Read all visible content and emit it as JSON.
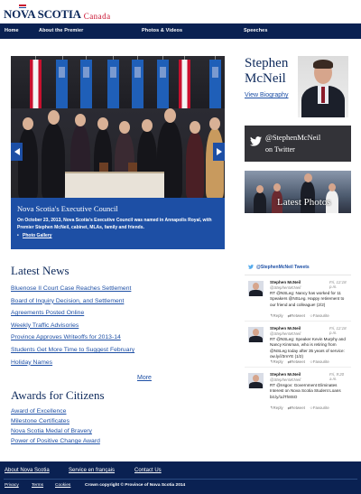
{
  "header": {
    "logo_main": "NOVA SCOTIA",
    "logo_sub": "Canada"
  },
  "nav": {
    "items": [
      "Home",
      "About the Premier",
      "Photos & Videos",
      "Speeches"
    ]
  },
  "hero": {
    "title": "Nova Scotia's Executive Council",
    "text": "On October 23, 2013, Nova Scotia's Executive Council was named in Annapolis Royal, with Premier Stephen McNeil, cabinet, MLAs, family and friends.",
    "link": "Photo Gallery",
    "prev_icon": "triangle-left",
    "next_icon": "triangle-right"
  },
  "premier": {
    "name_line1": "Stephen",
    "name_line2": "McNeil",
    "bio_link": "View Biography"
  },
  "twitter_box": {
    "handle": "@StephenMcNeil",
    "sub": "on Twitter"
  },
  "latest_photos": {
    "label": "Latest Photos"
  },
  "news": {
    "title": "Latest News",
    "items": [
      "Bluenose II Court Case Reaches Settlement",
      "Board of Inquiry Decision, and Settlement",
      "Agreements Posted Online",
      "Weekly Traffic Advisories",
      "Province Approves Writeoffs for 2013-14",
      "Students Get More Time to Suggest February",
      "Holiday Names"
    ],
    "more": "More"
  },
  "awards": {
    "title": "Awards for Citizens",
    "items": [
      "Award of Excellence",
      "Milestone Certificates",
      "Nova Scotia Medal of Bravery",
      "Power of Positive Change Award"
    ]
  },
  "tweets": {
    "header": "@StephenMcNeil Tweets",
    "list": [
      {
        "name": "Stephen McNeil",
        "handle": "@StephenMcNeil",
        "time": "Fri, 12:18 p.m.",
        "body": "RT @NSLeg: Nancy has worked for 11 Speakers @NSLeg. Happy retirement to our friend and colleague! (2/2)"
      },
      {
        "name": "Stephen McNeil",
        "handle": "@StephenMcNeil",
        "time": "Fri, 12:18 p.m.",
        "body": "RT @NSLeg: Speaker Kevin Murphy and Nancy Kinsman, who is retiring from @NSLeg today after 35 years of service: ow.ly/i/3mYE (1/2)"
      },
      {
        "name": "Stephen McNeil",
        "handle": "@StephenMcNeil",
        "time": "Fri, 9:20 a.m.",
        "body": "RT @nsgov: Government Eliminates Interest on Nova Scotia Student Loans bit.ly/1dTh8SO"
      }
    ],
    "actions": [
      "Reply",
      "Retweet",
      "Favourite"
    ]
  },
  "footer": {
    "links": [
      "About Nova Scotia",
      "Service en français",
      "Contact Us"
    ],
    "small_links": [
      "Privacy",
      "Terms",
      "Cookies"
    ],
    "copyright": "Crown copyright © Province of Nova Scotia 2014"
  },
  "colors": {
    "navy": "#0a2152",
    "accent_blue": "#1d4fa5",
    "brand_red": "#c8102e"
  }
}
